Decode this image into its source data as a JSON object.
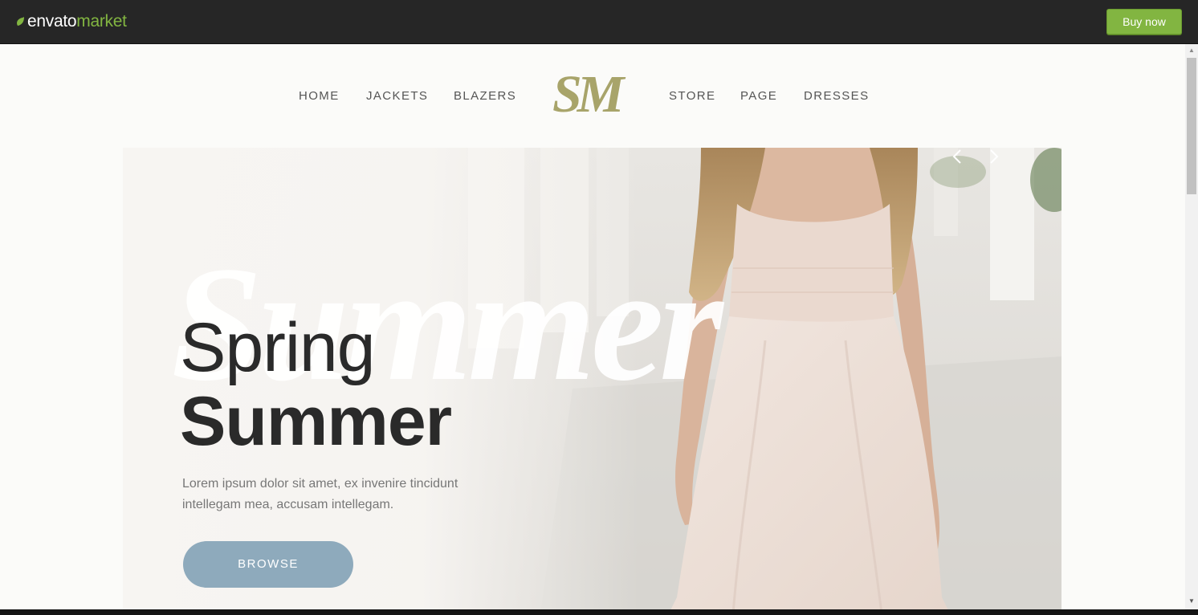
{
  "envato_bar": {
    "brand_part1": "envato",
    "brand_part2": "market",
    "buy_label": "Buy now",
    "accent": "#82b541"
  },
  "nav": {
    "items": [
      "HOME",
      "JACKETS",
      "BLAZERS",
      "STORE",
      "PAGE",
      "DRESSES"
    ],
    "logo_text": "SM",
    "logo_color": "#a8a46a"
  },
  "hero": {
    "background_word": "Summer",
    "title_line1": "Spring",
    "title_line2": "Summer",
    "description": "Lorem ipsum dolor sit amet, ex invenire tincidunt intellegam mea, accusam intellegam.",
    "button_label": "BROWSE",
    "button_color": "#8eaabc",
    "prev_icon": "chevron-left-icon",
    "next_icon": "chevron-right-icon"
  }
}
